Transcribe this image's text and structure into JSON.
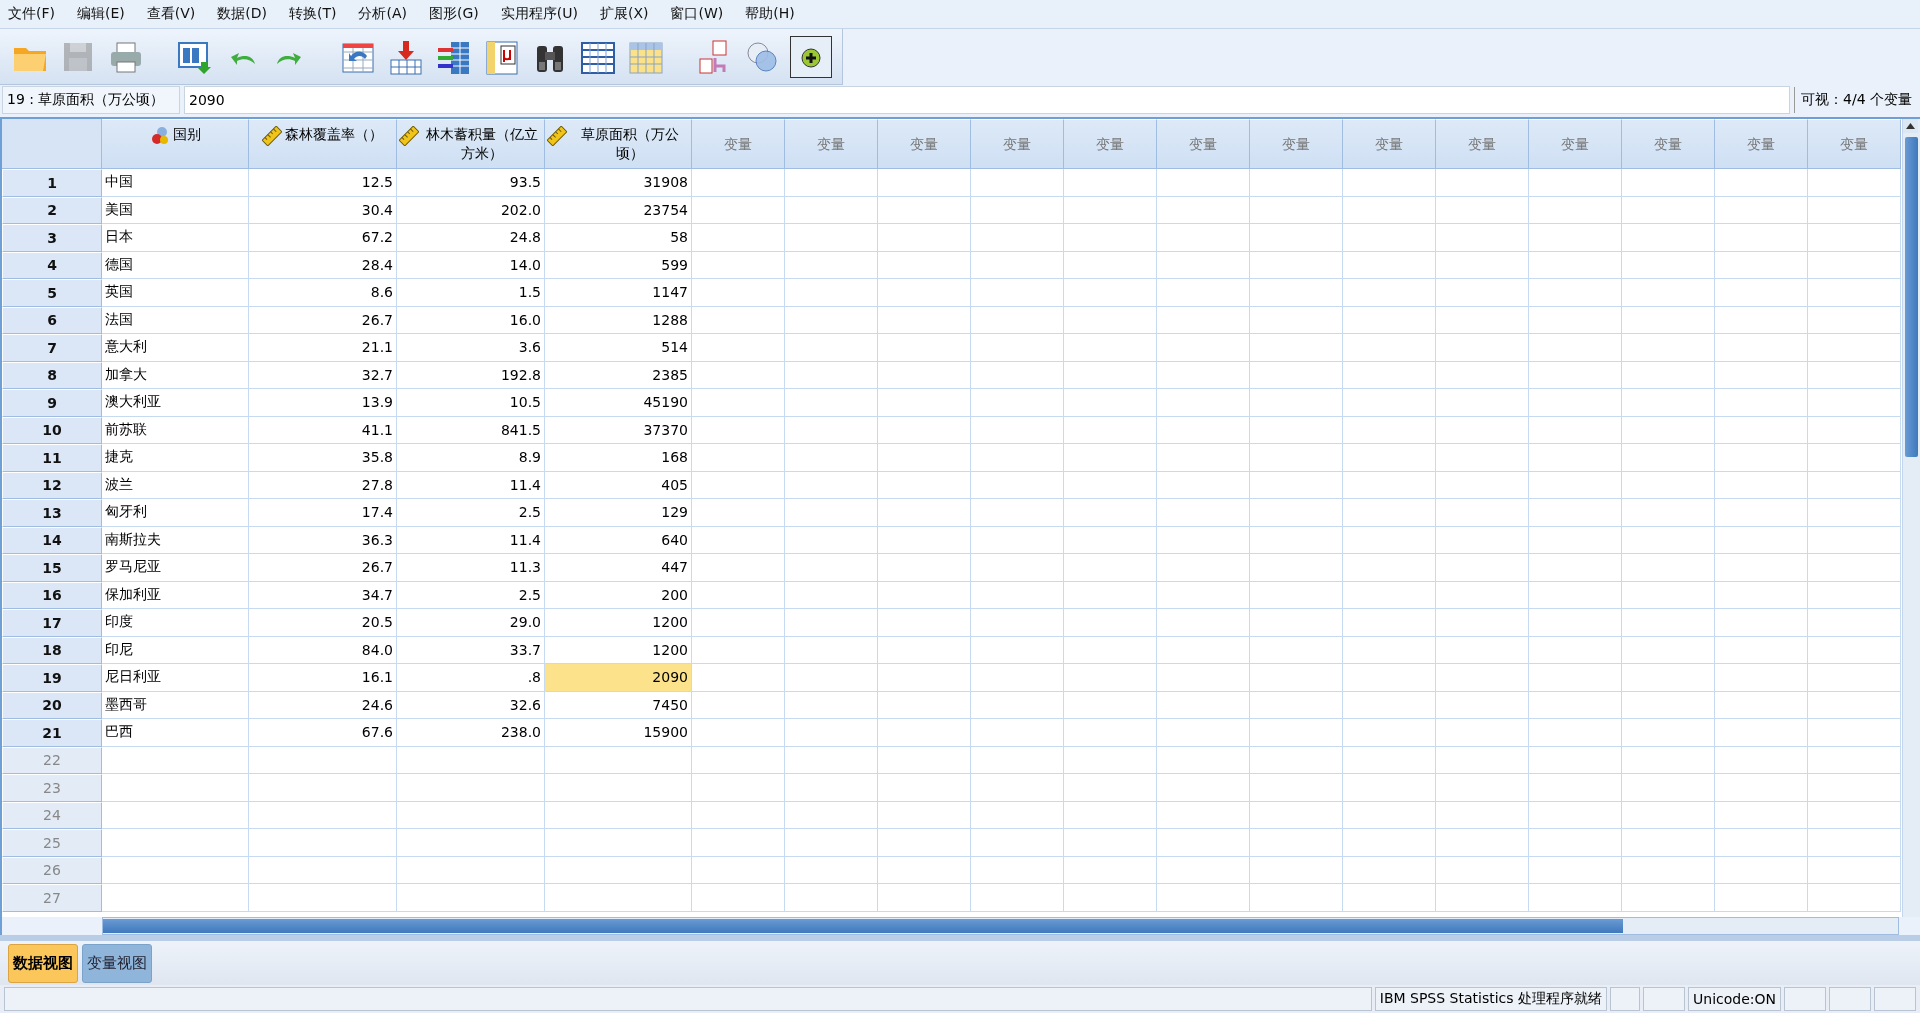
{
  "menu": [
    "文件(F)",
    "编辑(E)",
    "查看(V)",
    "数据(D)",
    "转换(T)",
    "分析(A)",
    "图形(G)",
    "实用程序(U)",
    "扩展(X)",
    "窗口(W)",
    "帮助(H)"
  ],
  "toolbar": [
    {
      "kind": "open",
      "disabled": false
    },
    {
      "kind": "save",
      "disabled": true
    },
    {
      "kind": "print",
      "disabled": false
    },
    {
      "kind": "recall",
      "disabled": false
    },
    {
      "kind": "undo",
      "disabled": false
    },
    {
      "kind": "redo",
      "disabled": false
    },
    {
      "kind": "gotocase",
      "disabled": false
    },
    {
      "kind": "gotovar",
      "disabled": false
    },
    {
      "kind": "variables",
      "disabled": false
    },
    {
      "kind": "stats",
      "disabled": false
    },
    {
      "kind": "find",
      "disabled": false
    },
    {
      "kind": "insertcase",
      "disabled": false
    },
    {
      "kind": "insertvar",
      "disabled": false
    },
    {
      "kind": "split",
      "disabled": false
    },
    {
      "kind": "circles",
      "disabled": false
    },
    {
      "kind": "sets",
      "disabled": false
    }
  ],
  "cell_editor": {
    "reference": "19 : 草原面积（万公顷）",
    "value": "2090",
    "visible": "可视：4/4 个变量"
  },
  "columns": [
    {
      "label": "国别",
      "kind": "nominal"
    },
    {
      "label": "森林覆盖率（）",
      "kind": "scale"
    },
    {
      "label": "林木蓄积量（亿立方米）",
      "kind": "scale"
    },
    {
      "label": "草原面积（万公顷）",
      "kind": "scale"
    },
    {
      "label": "变量",
      "kind": "empty"
    },
    {
      "label": "变量",
      "kind": "empty"
    },
    {
      "label": "变量",
      "kind": "empty"
    },
    {
      "label": "变量",
      "kind": "empty"
    },
    {
      "label": "变量",
      "kind": "empty"
    },
    {
      "label": "变量",
      "kind": "empty"
    },
    {
      "label": "变量",
      "kind": "empty"
    },
    {
      "label": "变量",
      "kind": "empty"
    },
    {
      "label": "变量",
      "kind": "empty"
    },
    {
      "label": "变量",
      "kind": "empty"
    },
    {
      "label": "变量",
      "kind": "empty"
    },
    {
      "label": "变量",
      "kind": "empty"
    },
    {
      "label": "变量",
      "kind": "empty"
    }
  ],
  "rows": [
    {
      "number": "1",
      "cells": [
        {
          "text": "中国",
          "selected": false
        },
        {
          "text": "12.5",
          "selected": false
        },
        {
          "text": "93.5",
          "selected": false
        },
        {
          "text": "31908",
          "selected": false
        }
      ]
    },
    {
      "number": "2",
      "cells": [
        {
          "text": "美国",
          "selected": false
        },
        {
          "text": "30.4",
          "selected": false
        },
        {
          "text": "202.0",
          "selected": false
        },
        {
          "text": "23754",
          "selected": false
        }
      ]
    },
    {
      "number": "3",
      "cells": [
        {
          "text": "日本",
          "selected": false
        },
        {
          "text": "67.2",
          "selected": false
        },
        {
          "text": "24.8",
          "selected": false
        },
        {
          "text": "58",
          "selected": false
        }
      ]
    },
    {
      "number": "4",
      "cells": [
        {
          "text": "德国",
          "selected": false
        },
        {
          "text": "28.4",
          "selected": false
        },
        {
          "text": "14.0",
          "selected": false
        },
        {
          "text": "599",
          "selected": false
        }
      ]
    },
    {
      "number": "5",
      "cells": [
        {
          "text": "英国",
          "selected": false
        },
        {
          "text": "8.6",
          "selected": false
        },
        {
          "text": "1.5",
          "selected": false
        },
        {
          "text": "1147",
          "selected": false
        }
      ]
    },
    {
      "number": "6",
      "cells": [
        {
          "text": "法国",
          "selected": false
        },
        {
          "text": "26.7",
          "selected": false
        },
        {
          "text": "16.0",
          "selected": false
        },
        {
          "text": "1288",
          "selected": false
        }
      ]
    },
    {
      "number": "7",
      "cells": [
        {
          "text": "意大利",
          "selected": false
        },
        {
          "text": "21.1",
          "selected": false
        },
        {
          "text": "3.6",
          "selected": false
        },
        {
          "text": "514",
          "selected": false
        }
      ]
    },
    {
      "number": "8",
      "cells": [
        {
          "text": "加拿大",
          "selected": false
        },
        {
          "text": "32.7",
          "selected": false
        },
        {
          "text": "192.8",
          "selected": false
        },
        {
          "text": "2385",
          "selected": false
        }
      ]
    },
    {
      "number": "9",
      "cells": [
        {
          "text": "澳大利亚",
          "selected": false
        },
        {
          "text": "13.9",
          "selected": false
        },
        {
          "text": "10.5",
          "selected": false
        },
        {
          "text": "45190",
          "selected": false
        }
      ]
    },
    {
      "number": "10",
      "cells": [
        {
          "text": "前苏联",
          "selected": false
        },
        {
          "text": "41.1",
          "selected": false
        },
        {
          "text": "841.5",
          "selected": false
        },
        {
          "text": "37370",
          "selected": false
        }
      ]
    },
    {
      "number": "11",
      "cells": [
        {
          "text": "捷克",
          "selected": false
        },
        {
          "text": "35.8",
          "selected": false
        },
        {
          "text": "8.9",
          "selected": false
        },
        {
          "text": "168",
          "selected": false
        }
      ]
    },
    {
      "number": "12",
      "cells": [
        {
          "text": "波兰",
          "selected": false
        },
        {
          "text": "27.8",
          "selected": false
        },
        {
          "text": "11.4",
          "selected": false
        },
        {
          "text": "405",
          "selected": false
        }
      ]
    },
    {
      "number": "13",
      "cells": [
        {
          "text": "匈牙利",
          "selected": false
        },
        {
          "text": "17.4",
          "selected": false
        },
        {
          "text": "2.5",
          "selected": false
        },
        {
          "text": "129",
          "selected": false
        }
      ]
    },
    {
      "number": "14",
      "cells": [
        {
          "text": "南斯拉夫",
          "selected": false
        },
        {
          "text": "36.3",
          "selected": false
        },
        {
          "text": "11.4",
          "selected": false
        },
        {
          "text": "640",
          "selected": false
        }
      ]
    },
    {
      "number": "15",
      "cells": [
        {
          "text": "罗马尼亚",
          "selected": false
        },
        {
          "text": "26.7",
          "selected": false
        },
        {
          "text": "11.3",
          "selected": false
        },
        {
          "text": "447",
          "selected": false
        }
      ]
    },
    {
      "number": "16",
      "cells": [
        {
          "text": "保加利亚",
          "selected": false
        },
        {
          "text": "34.7",
          "selected": false
        },
        {
          "text": "2.5",
          "selected": false
        },
        {
          "text": "200",
          "selected": false
        }
      ]
    },
    {
      "number": "17",
      "cells": [
        {
          "text": "印度",
          "selected": false
        },
        {
          "text": "20.5",
          "selected": false
        },
        {
          "text": "29.0",
          "selected": false
        },
        {
          "text": "1200",
          "selected": false
        }
      ]
    },
    {
      "number": "18",
      "cells": [
        {
          "text": "印尼",
          "selected": false
        },
        {
          "text": "84.0",
          "selected": false
        },
        {
          "text": "33.7",
          "selected": false
        },
        {
          "text": "1200",
          "selected": false
        }
      ]
    },
    {
      "number": "19",
      "cells": [
        {
          "text": "尼日利亚",
          "selected": false
        },
        {
          "text": "16.1",
          "selected": false
        },
        {
          "text": ".8",
          "selected": false
        },
        {
          "text": "2090",
          "selected": true
        }
      ]
    },
    {
      "number": "20",
      "cells": [
        {
          "text": "墨西哥",
          "selected": false
        },
        {
          "text": "24.6",
          "selected": false
        },
        {
          "text": "32.6",
          "selected": false
        },
        {
          "text": "7450",
          "selected": false
        }
      ]
    },
    {
      "number": "21",
      "cells": [
        {
          "text": "巴西",
          "selected": false
        },
        {
          "text": "67.6",
          "selected": false
        },
        {
          "text": "238.0",
          "selected": false
        },
        {
          "text": "15900",
          "selected": false
        }
      ]
    },
    {
      "number": "22"
    },
    {
      "number": "23"
    },
    {
      "number": "24"
    },
    {
      "number": "25"
    },
    {
      "number": "26"
    },
    {
      "number": "27"
    }
  ],
  "view_tabs": [
    {
      "label": "数据视图",
      "selected": true
    },
    {
      "label": "变量视图",
      "selected": false
    }
  ],
  "status_bar": {
    "message": "IBM SPSS Statistics 处理程序就绪",
    "encoding": "Unicode:ON"
  }
}
